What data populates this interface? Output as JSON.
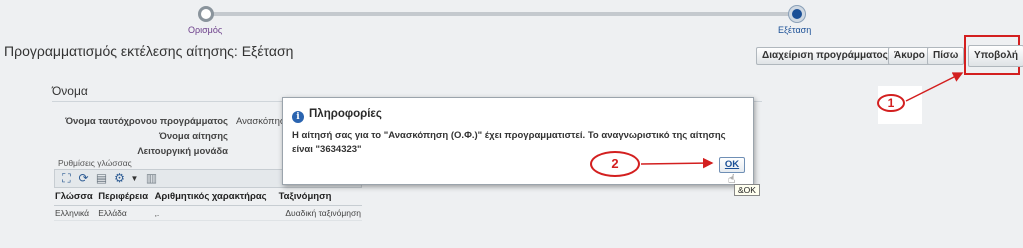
{
  "train": {
    "stop1_label": "Ορισμός",
    "stop2_label": "Εξέταση"
  },
  "page_title": "Προγραμματισμός εκτέλεσης αίτησης: Εξέταση",
  "buttons": {
    "manage_schedule": "Διαχείριση προγράμματος",
    "cancel": "Άκυρο",
    "back": "Πίσω",
    "submit": "Υποβολή"
  },
  "section": {
    "title": "Όνομα",
    "fields": [
      {
        "label": "Όνομα ταυτόχρονου προγράμματος",
        "value": "Ανασκόπηση"
      },
      {
        "label": "Όνομα αίτησης",
        "value": ""
      },
      {
        "label": "Λειτουργική μονάδα",
        "value": ""
      }
    ]
  },
  "language_settings": {
    "caption": "Ρυθμίσεις γλώσσας",
    "columns": [
      "Γλώσσα",
      "Περιφέρεια",
      "Αριθμητικός χαρακτήρας",
      "Ταξινόμηση"
    ],
    "rows": [
      [
        "Ελληνικά",
        "Ελλάδα",
        ",.",
        "Δυαδική ταξινόμηση"
      ]
    ]
  },
  "dialog": {
    "title": "Πληροφορίες",
    "message": "Η αίτησή σας για το \"Ανασκόπηση (Ο.Φ.)\" έχει προγραμματιστεί. Το αναγνωριστικό της αίτησης είναι \"3634323\"",
    "ok_label": "OK",
    "ok_tooltip": "&OK"
  },
  "annotations": {
    "callout_1": "1",
    "callout_2": "2",
    "color": "#d31f1f"
  },
  "icons": [
    "info-icon",
    "detach-icon",
    "refresh-icon",
    "export-icon",
    "gear-icon",
    "chevron-down-icon",
    "freeze-icon",
    "hand-cursor-icon"
  ]
}
